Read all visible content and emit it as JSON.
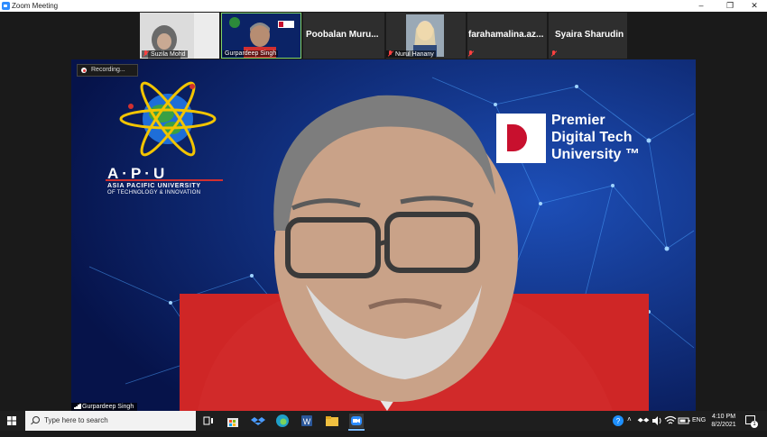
{
  "window": {
    "title": "Zoom Meeting",
    "minimize": "–",
    "restore": "❐",
    "close": "✕"
  },
  "participants": [
    {
      "name": "Suzila Mohd"
    },
    {
      "name": "Gurpardeep Singh"
    },
    {
      "name": "Poobalan Muru..."
    },
    {
      "name": "Nurul Hanany"
    },
    {
      "name": "farahamalina.az..."
    },
    {
      "name": "Syaira Sharudin"
    }
  ],
  "main_video": {
    "recording_label": "Recording...",
    "speaker_name": "Gurpardeep Singh",
    "apu_logo": {
      "letters": "A·P·U",
      "line1": "ASIA PACIFIC UNIVERSITY",
      "line2": "OF TECHNOLOGY & INNOVATION"
    },
    "pdtu_logo": {
      "line1": "Premier",
      "line2": "Digital Tech",
      "line3": "University ™"
    }
  },
  "taskbar": {
    "search_placeholder": "Type here to search",
    "language": "ENG",
    "time": "4:10 PM",
    "date": "8/2/2021",
    "notification_count": "1"
  },
  "colors": {
    "zoom_blue": "#2d8cff",
    "muted_red": "#ff4040",
    "background": "#0a1c5c",
    "brand_red": "#c8102e"
  }
}
